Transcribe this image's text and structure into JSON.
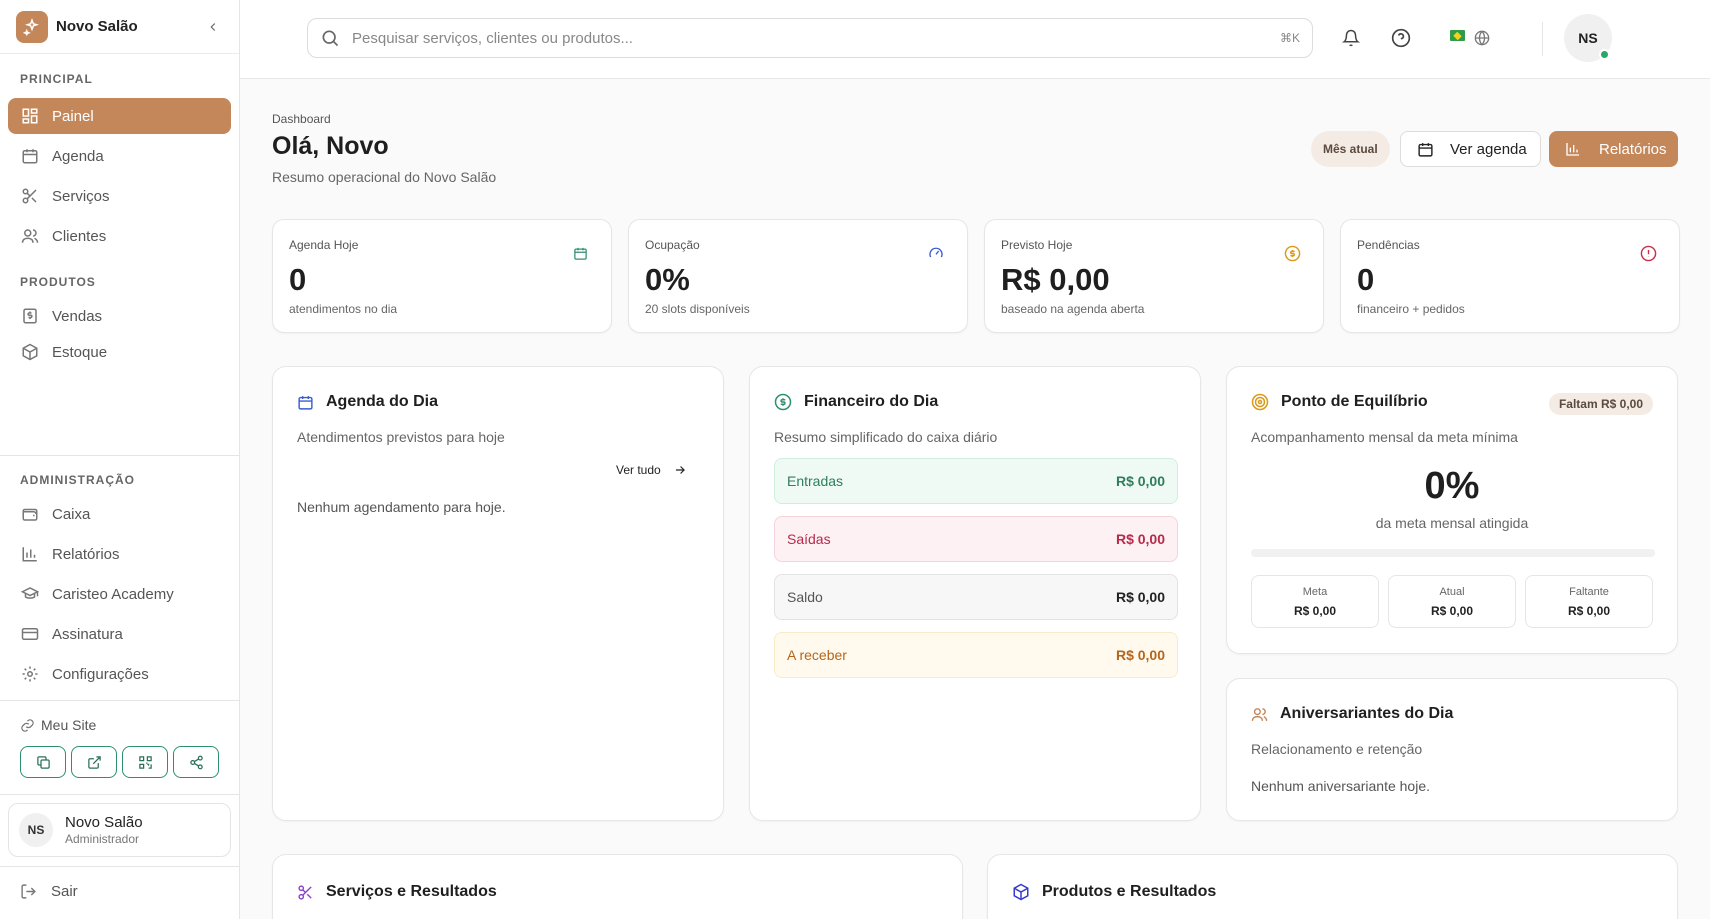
{
  "brand": {
    "name": "Novo Salão"
  },
  "sidebar": {
    "principal_title": "PRINCIPAL",
    "principal": [
      {
        "label": "Painel",
        "icon": "grid-icon",
        "active": true
      },
      {
        "label": "Agenda",
        "icon": "calendar-icon"
      },
      {
        "label": "Serviços",
        "icon": "scissors-icon"
      },
      {
        "label": "Clientes",
        "icon": "users-icon"
      }
    ],
    "produtos_title": "PRODUTOS",
    "produtos": [
      {
        "label": "Vendas",
        "icon": "receipt-icon"
      },
      {
        "label": "Estoque",
        "icon": "box-icon"
      }
    ],
    "admin_title": "ADMINISTRAÇÃO",
    "admin": [
      {
        "label": "Caixa",
        "icon": "wallet-icon"
      },
      {
        "label": "Relatórios",
        "icon": "bar-chart-icon"
      },
      {
        "label": "Caristeo Academy",
        "icon": "graduation-cap-icon"
      },
      {
        "label": "Assinatura",
        "icon": "credit-card-icon"
      },
      {
        "label": "Configurações",
        "icon": "gear-icon"
      }
    ],
    "site_label": "Meu Site",
    "user": {
      "initials": "NS",
      "name": "Novo Salão",
      "role": "Administrador"
    },
    "logout": "Sair"
  },
  "topbar": {
    "search_placeholder": "Pesquisar serviços, clientes ou produtos...",
    "shortcut": "⌘K",
    "avatar_initials": "NS"
  },
  "header": {
    "breadcrumb": "Dashboard",
    "greeting": "Olá, Novo",
    "subtitle": "Resumo operacional do Novo Salão",
    "month_button": "Mês atual",
    "agenda_button": "Ver agenda",
    "reports_button": "Relatórios"
  },
  "kpis": [
    {
      "label": "Agenda Hoje",
      "value": "0",
      "sub": "atendimentos no dia",
      "icon": "calendar-icon",
      "color": "#2e8f70"
    },
    {
      "label": "Ocupação",
      "value": "0%",
      "sub": "20 slots disponíveis",
      "icon": "gauge-icon",
      "color": "#3a5bd1"
    },
    {
      "label": "Previsto Hoje",
      "value": "R$ 0,00",
      "sub": "baseado na agenda aberta",
      "icon": "dollar-circle-icon",
      "color": "#d99a1a"
    },
    {
      "label": "Pendências",
      "value": "0",
      "sub": "financeiro + pedidos",
      "icon": "alert-circle-icon",
      "color": "#c9304f"
    }
  ],
  "agenda": {
    "title": "Agenda do Dia",
    "subtitle": "Atendimentos previstos para hoje",
    "see_all": "Ver tudo",
    "empty": "Nenhum agendamento para hoje."
  },
  "finance": {
    "title": "Financeiro do Dia",
    "subtitle": "Resumo simplificado do caixa diário",
    "rows": [
      {
        "label": "Entradas",
        "value": "R$ 0,00",
        "bg": "#f0faf5",
        "border": "#cfeede",
        "text": "#2e7d5c"
      },
      {
        "label": "Saídas",
        "value": "R$ 0,00",
        "bg": "#fdf1f3",
        "border": "#f6d3da",
        "text": "#b8294a"
      },
      {
        "label": "Saldo",
        "value": "R$ 0,00",
        "bg": "#f7f7f7",
        "border": "#e3e3e3",
        "text": "#555555"
      },
      {
        "label": "A receber",
        "value": "R$ 0,00",
        "bg": "#fffaed",
        "border": "#f7ebc8",
        "text": "#b5651d"
      }
    ]
  },
  "breakeven": {
    "title": "Ponto de Equilíbrio",
    "pill": "Faltam R$ 0,00",
    "subtitle": "Acompanhamento mensal da meta mínima",
    "percent": "0%",
    "percent_label": "da meta mensal atingida",
    "progress": 0,
    "stats": [
      {
        "label": "Meta",
        "value": "R$ 0,00"
      },
      {
        "label": "Atual",
        "value": "R$ 0,00"
      },
      {
        "label": "Faltante",
        "value": "R$ 0,00"
      }
    ]
  },
  "birthdays": {
    "title": "Aniversariantes do Dia",
    "subtitle": "Relacionamento e retenção",
    "empty": "Nenhum aniversariante hoje."
  },
  "services_panel": {
    "title": "Serviços e Resultados"
  },
  "products_panel": {
    "title": "Produtos e Resultados"
  },
  "colors": {
    "accent": "#c4875a",
    "green": "#2e8f70"
  }
}
